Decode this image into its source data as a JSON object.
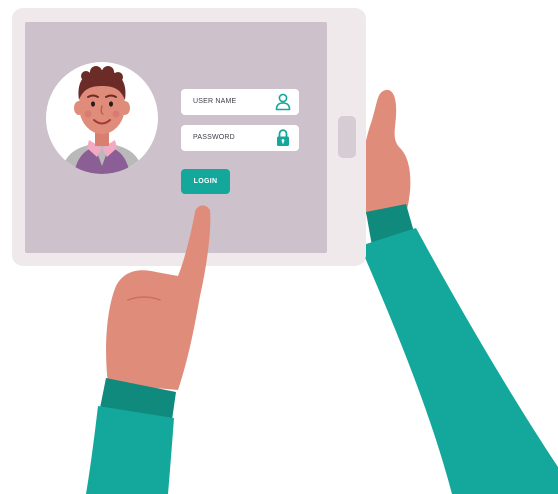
{
  "login_form": {
    "username_label": "USER NAME",
    "password_label": "PASSWORD",
    "login_label": "LOGIN"
  },
  "icons": {
    "username": "user-icon",
    "password": "lock-icon"
  },
  "colors": {
    "tablet_frame": "#efe9eb",
    "tablet_screen": "#cdc2cb",
    "accent_teal": "#14a89c",
    "sleeve_dark": "#0f8a7c",
    "skin": "#e08c7b",
    "avatar_bg": "#ffffff",
    "hair": "#6b2c28",
    "vest": "#8c5e96",
    "collar": "#f2a9c2"
  }
}
